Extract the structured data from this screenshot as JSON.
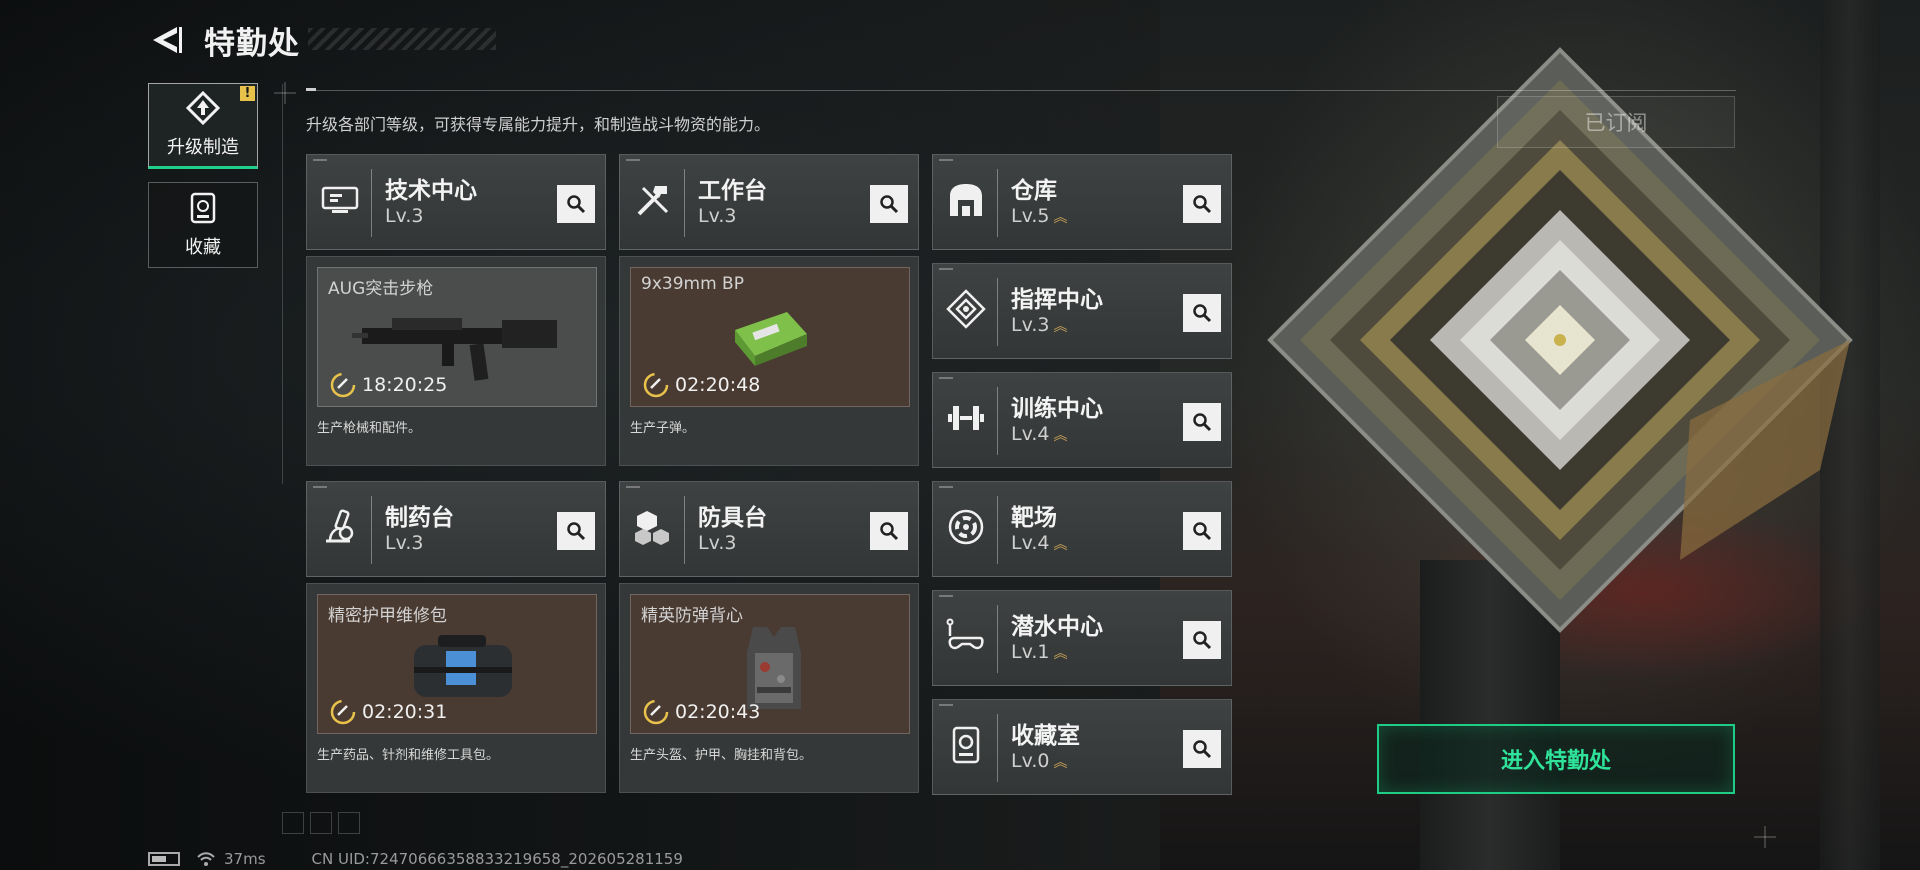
{
  "header": {
    "title": "特勤处",
    "intro": "升级各部门等级，可获得专属能力提升，和制造战斗物资的能力。",
    "subscribed_label": "已订阅"
  },
  "tabs": [
    {
      "label": "升级制造",
      "icon": "upgrade-icon",
      "active": true,
      "badge": "!"
    },
    {
      "label": "收藏",
      "icon": "collection-icon",
      "active": false
    }
  ],
  "production_departments": [
    {
      "name": "技术中心",
      "level": "Lv.3",
      "icon": "tech-center-icon",
      "item": "AUG突击步枪",
      "timer": "18:20:25",
      "desc": "生产枪械和配件。",
      "slot_color": "grey"
    },
    {
      "name": "工作台",
      "level": "Lv.3",
      "icon": "workbench-icon",
      "item": "9x39mm BP",
      "timer": "02:20:48",
      "desc": "生产子弹。",
      "slot_color": "brown"
    },
    {
      "name": "制药台",
      "level": "Lv.3",
      "icon": "pharmacy-icon",
      "item": "精密护甲维修包",
      "timer": "02:20:31",
      "desc": "生产药品、针剂和维修工具包。",
      "slot_color": "brown"
    },
    {
      "name": "防具台",
      "level": "Lv.3",
      "icon": "armor-bench-icon",
      "item": "精英防弹背心",
      "timer": "02:20:43",
      "desc": "生产头盔、护甲、胸挂和背包。",
      "slot_color": "brown"
    }
  ],
  "side_departments": [
    {
      "name": "仓库",
      "level": "Lv.5",
      "icon": "warehouse-icon"
    },
    {
      "name": "指挥中心",
      "level": "Lv.3",
      "icon": "command-center-icon"
    },
    {
      "name": "训练中心",
      "level": "Lv.4",
      "icon": "training-center-icon"
    },
    {
      "name": "靶场",
      "level": "Lv.4",
      "icon": "shooting-range-icon"
    },
    {
      "name": "潜水中心",
      "level": "Lv.1",
      "icon": "diving-center-icon"
    },
    {
      "name": "收藏室",
      "level": "Lv.0",
      "icon": "collection-room-icon"
    }
  ],
  "enter_button": "进入特勤处",
  "footer": {
    "ping": "37ms",
    "uid": "CN UID:7247066635883321965​8_202605281159"
  },
  "colors": {
    "accent_green": "#1fcc86",
    "level_up_gold": "#c9a356",
    "badge_yellow": "#e8c24a"
  }
}
